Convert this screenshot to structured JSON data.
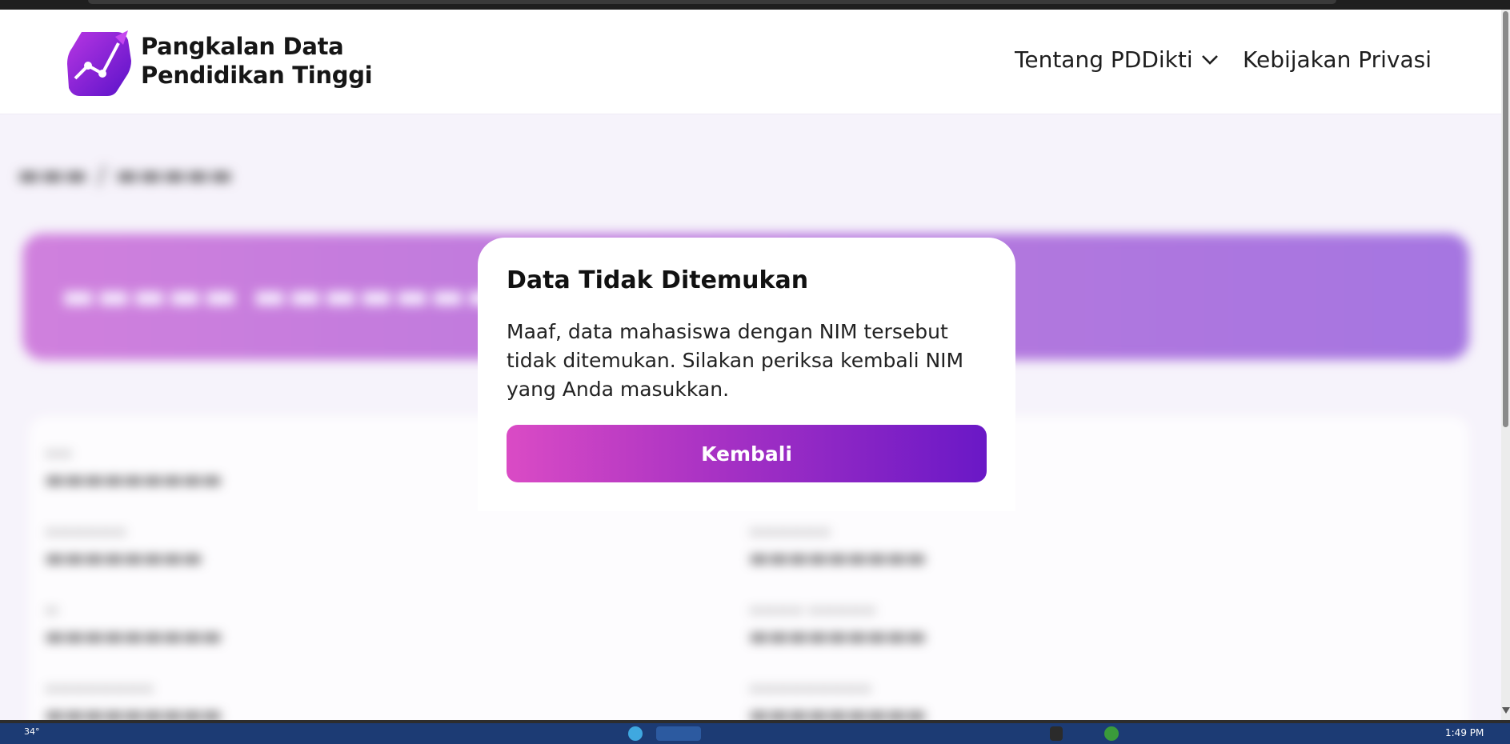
{
  "header": {
    "brand_line1": "Pangkalan Data",
    "brand_line2": "Pendidikan Tinggi",
    "nav_about": "Tentang PDDikti",
    "nav_privacy": "Kebijakan Privasi"
  },
  "modal": {
    "title": "Data Tidak Ditemukan",
    "message": "Maaf, data mahasiswa dengan NIM tersebut tidak ditemukan. Silakan periksa kembali NIM yang Anda masukkan.",
    "button": "Kembali"
  },
  "taskbar": {
    "weather": "34°",
    "time": "1:49 PM"
  },
  "colors": {
    "accent": "#7b2bd1",
    "button_start": "#da4bc5",
    "button_end": "#6a18c6",
    "banner": "#a44fd3"
  },
  "icons": {
    "logo": "pddikti-logo-icon",
    "dropdown": "chevron-down-icon"
  }
}
